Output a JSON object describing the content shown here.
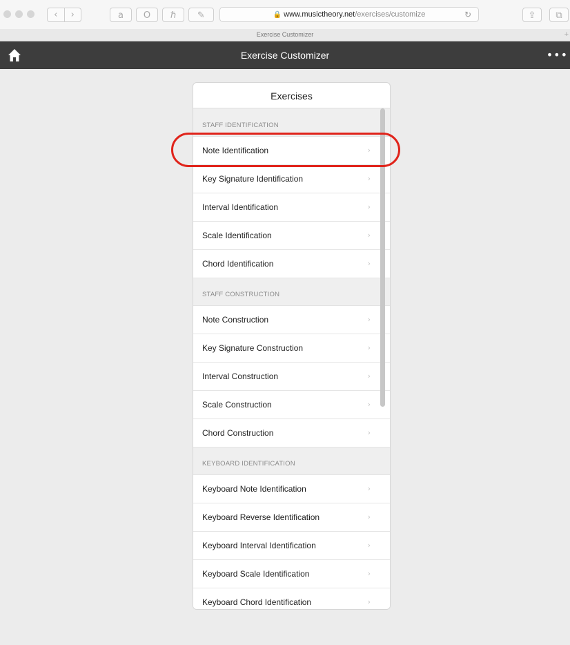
{
  "browser": {
    "url_domain": "www.musictheory.net",
    "url_path": "/exercises/customize",
    "tab_title": "Exercise Customizer",
    "new_tab": "+",
    "toolbar": {
      "back": "‹",
      "forward": "›",
      "amazon": "a",
      "opera": "O",
      "ext": "ℏ",
      "edit": "✎",
      "share": "⇪",
      "tabs": "⧉"
    }
  },
  "header": {
    "title": "Exercise Customizer",
    "more": "•••"
  },
  "card": {
    "title": "Exercises",
    "sections": [
      {
        "header": "STAFF IDENTIFICATION",
        "items": [
          "Note Identification",
          "Key Signature Identification",
          "Interval Identification",
          "Scale Identification",
          "Chord Identification"
        ]
      },
      {
        "header": "STAFF CONSTRUCTION",
        "items": [
          "Note Construction",
          "Key Signature Construction",
          "Interval Construction",
          "Scale Construction",
          "Chord Construction"
        ]
      },
      {
        "header": "KEYBOARD IDENTIFICATION",
        "items": [
          "Keyboard Note Identification",
          "Keyboard Reverse Identification",
          "Keyboard Interval Identification",
          "Keyboard Scale Identification",
          "Keyboard Chord Identification"
        ]
      }
    ],
    "chevron": "›"
  },
  "colors": {
    "header_bg": "#3d3d3d",
    "highlight": "#e0241b",
    "page_bg": "#ececec"
  }
}
